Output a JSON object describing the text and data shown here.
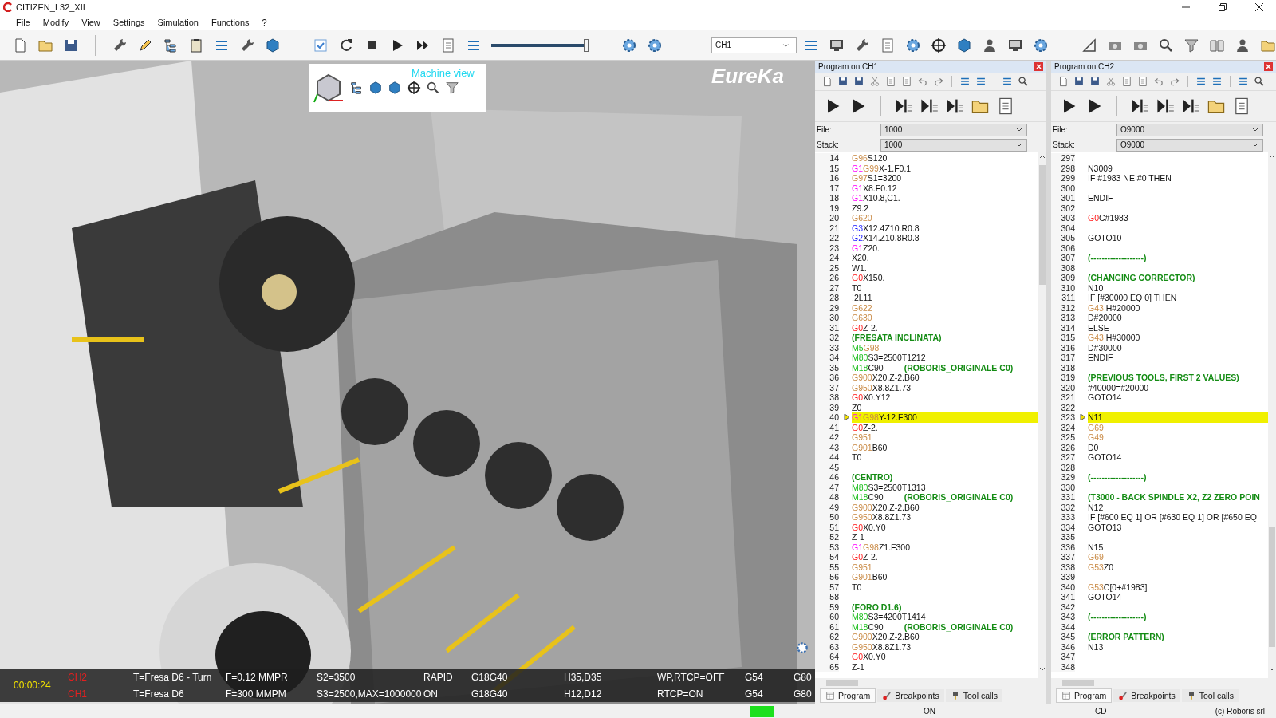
{
  "window": {
    "title": "CITIZEN_L32_XII"
  },
  "menu": [
    "File",
    "Modify",
    "View",
    "Settings",
    "Simulation",
    "Functions",
    "?"
  ],
  "toolbar": {
    "speed_slider": {
      "level": 0.97
    },
    "channel": "CH1"
  },
  "viewport": {
    "view_label": "Machine view",
    "logo": "EureKa",
    "timer": "00:00:24",
    "channels": [
      {
        "name": "CH2",
        "tool": "T=Fresa D6 - Turn",
        "feed": "F=0.12 MMPR",
        "speed": "S2=3500",
        "motion": "RAPID",
        "plane": "G18G40",
        "offsets": "H35,D35",
        "rtcp": "WP,RTCP=OFF",
        "work": "G54",
        "cycle": "G80"
      },
      {
        "name": "CH1",
        "tool": "T=Fresa D6",
        "feed": "F=300 MMPM",
        "speed": "S3=2500,MAX=1000000",
        "motion": "ON",
        "plane": "G18G40",
        "offsets": "H12,D12",
        "rtcp": "RTCP=ON",
        "work": "G54",
        "cycle": "G80"
      }
    ]
  },
  "panels": [
    {
      "title": "Program on CH1",
      "file": {
        "label": "File:",
        "value": "1000"
      },
      "stack": {
        "label": "Stack:",
        "value": "1000"
      },
      "lines": [
        {
          "n": "14",
          "current": false,
          "code": [
            {
              "text": "G96",
              "kind": "modal"
            },
            {
              "text": "S120",
              "kind": "plain"
            }
          ]
        },
        {
          "n": "15",
          "current": false,
          "code": [
            {
              "text": "G1",
              "kind": "linear"
            },
            {
              "text": "G99",
              "kind": "modal"
            },
            {
              "text": "X-1.F0.1",
              "kind": "plain"
            }
          ]
        },
        {
          "n": "16",
          "current": false,
          "code": [
            {
              "text": "G97",
              "kind": "modal"
            },
            {
              "text": "S1=3200",
              "kind": "plain"
            }
          ]
        },
        {
          "n": "17",
          "current": false,
          "code": [
            {
              "text": "G1",
              "kind": "linear"
            },
            {
              "text": "X8.F0.12",
              "kind": "plain"
            }
          ]
        },
        {
          "n": "18",
          "current": false,
          "code": [
            {
              "text": "G1",
              "kind": "linear"
            },
            {
              "text": "X10.8,C1.",
              "kind": "plain"
            }
          ]
        },
        {
          "n": "19",
          "current": false,
          "code": [
            {
              "text": "Z9.2",
              "kind": "plain"
            }
          ]
        },
        {
          "n": "20",
          "current": false,
          "code": [
            {
              "text": "G620",
              "kind": "modal"
            }
          ]
        },
        {
          "n": "21",
          "current": false,
          "code": [
            {
              "text": "G3",
              "kind": "arc"
            },
            {
              "text": "X12.4Z10.R0.8",
              "kind": "plain"
            }
          ]
        },
        {
          "n": "22",
          "current": false,
          "code": [
            {
              "text": "G2",
              "kind": "arc"
            },
            {
              "text": "X14.Z10.8R0.8",
              "kind": "plain"
            }
          ]
        },
        {
          "n": "23",
          "current": false,
          "code": [
            {
              "text": "G1",
              "kind": "linear"
            },
            {
              "text": "Z20.",
              "kind": "plain"
            }
          ]
        },
        {
          "n": "24",
          "current": false,
          "code": [
            {
              "text": "X20.",
              "kind": "plain"
            }
          ]
        },
        {
          "n": "25",
          "current": false,
          "code": [
            {
              "text": "W1.",
              "kind": "plain"
            }
          ]
        },
        {
          "n": "26",
          "current": false,
          "code": [
            {
              "text": "G0",
              "kind": "rapid"
            },
            {
              "text": "X150.",
              "kind": "plain"
            }
          ]
        },
        {
          "n": "27",
          "current": false,
          "code": [
            {
              "text": "T0",
              "kind": "plain"
            }
          ]
        },
        {
          "n": "28",
          "current": false,
          "code": [
            {
              "text": "!2L11",
              "kind": "plain"
            }
          ]
        },
        {
          "n": "29",
          "current": false,
          "code": [
            {
              "text": "G622",
              "kind": "modal"
            }
          ]
        },
        {
          "n": "30",
          "current": false,
          "code": [
            {
              "text": "G630",
              "kind": "modal"
            }
          ]
        },
        {
          "n": "31",
          "current": false,
          "code": [
            {
              "text": "G0",
              "kind": "rapid"
            },
            {
              "text": "Z-2.",
              "kind": "plain"
            }
          ]
        },
        {
          "n": "32",
          "current": false,
          "code": [
            {
              "text": "(FRESATA INCLINATA)",
              "kind": "comment"
            }
          ]
        },
        {
          "n": "33",
          "current": false,
          "code": [
            {
              "text": "M5",
              "kind": "mcode"
            },
            {
              "text": "G98",
              "kind": "modal"
            }
          ]
        },
        {
          "n": "34",
          "current": false,
          "code": [
            {
              "text": "M80",
              "kind": "mcode"
            },
            {
              "text": "S3=2500T1212",
              "kind": "plain"
            }
          ]
        },
        {
          "n": "35",
          "current": false,
          "code": [
            {
              "text": "M18",
              "kind": "mcode"
            },
            {
              "text": "C90",
              "kind": "plain"
            },
            {
              "text": "(ROBORIS_ORIGINALE C0)",
              "kind": "comment"
            }
          ]
        },
        {
          "n": "36",
          "current": false,
          "code": [
            {
              "text": "G900",
              "kind": "modal"
            },
            {
              "text": "X20.Z-2.B60",
              "kind": "plain"
            }
          ]
        },
        {
          "n": "37",
          "current": false,
          "code": [
            {
              "text": "G950",
              "kind": "modal"
            },
            {
              "text": "X8.8Z1.73",
              "kind": "plain"
            }
          ]
        },
        {
          "n": "38",
          "current": false,
          "code": [
            {
              "text": "G0",
              "kind": "rapid"
            },
            {
              "text": "X0.Y12",
              "kind": "plain"
            }
          ]
        },
        {
          "n": "39",
          "current": false,
          "code": [
            {
              "text": "Z0",
              "kind": "plain"
            }
          ]
        },
        {
          "n": "40",
          "current": true,
          "code": [
            {
              "text": "G1",
              "kind": "linear"
            },
            {
              "text": "G98",
              "kind": "modal"
            },
            {
              "text": "Y-12.F300",
              "kind": "plain"
            }
          ]
        },
        {
          "n": "41",
          "current": false,
          "code": [
            {
              "text": "G0",
              "kind": "rapid"
            },
            {
              "text": "Z-2.",
              "kind": "plain"
            }
          ]
        },
        {
          "n": "42",
          "current": false,
          "code": [
            {
              "text": "G951",
              "kind": "modal"
            }
          ]
        },
        {
          "n": "43",
          "current": false,
          "code": [
            {
              "text": "G901",
              "kind": "modal"
            },
            {
              "text": "B60",
              "kind": "plain"
            }
          ]
        },
        {
          "n": "44",
          "current": false,
          "code": [
            {
              "text": "T0",
              "kind": "plain"
            }
          ]
        },
        {
          "n": "45",
          "current": false
        },
        {
          "n": "46",
          "current": false,
          "code": [
            {
              "text": "(CENTRO)",
              "kind": "comment"
            }
          ]
        },
        {
          "n": "47",
          "current": false,
          "code": [
            {
              "text": "M80",
              "kind": "mcode"
            },
            {
              "text": "S3=2500T1313",
              "kind": "plain"
            }
          ]
        },
        {
          "n": "48",
          "current": false,
          "code": [
            {
              "text": "M18",
              "kind": "mcode"
            },
            {
              "text": "C90",
              "kind": "plain"
            },
            {
              "text": "(ROBORIS_ORIGINALE C0)",
              "kind": "comment"
            }
          ]
        },
        {
          "n": "49",
          "current": false,
          "code": [
            {
              "text": "G900",
              "kind": "modal"
            },
            {
              "text": "X20.Z-2.B60",
              "kind": "plain"
            }
          ]
        },
        {
          "n": "50",
          "current": false,
          "code": [
            {
              "text": "G950",
              "kind": "modal"
            },
            {
              "text": "X8.8Z1.73",
              "kind": "plain"
            }
          ]
        },
        {
          "n": "51",
          "current": false,
          "code": [
            {
              "text": "G0",
              "kind": "rapid"
            },
            {
              "text": "X0.Y0",
              "kind": "plain"
            }
          ]
        },
        {
          "n": "52",
          "current": false,
          "code": [
            {
              "text": "Z-1",
              "kind": "plain"
            }
          ]
        },
        {
          "n": "53",
          "current": false,
          "code": [
            {
              "text": "G1",
              "kind": "linear"
            },
            {
              "text": "G98",
              "kind": "modal"
            },
            {
              "text": "Z1.F300",
              "kind": "plain"
            }
          ]
        },
        {
          "n": "54",
          "current": false,
          "code": [
            {
              "text": "G0",
              "kind": "rapid"
            },
            {
              "text": "Z-2.",
              "kind": "plain"
            }
          ]
        },
        {
          "n": "55",
          "current": false,
          "code": [
            {
              "text": "G951",
              "kind": "modal"
            }
          ]
        },
        {
          "n": "56",
          "current": false,
          "code": [
            {
              "text": "G901",
              "kind": "modal"
            },
            {
              "text": "B60",
              "kind": "plain"
            }
          ]
        },
        {
          "n": "57",
          "current": false,
          "code": [
            {
              "text": "T0",
              "kind": "plain"
            }
          ]
        },
        {
          "n": "58",
          "current": false
        },
        {
          "n": "59",
          "current": false,
          "code": [
            {
              "text": "(FORO D1.6)",
              "kind": "comment"
            }
          ]
        },
        {
          "n": "60",
          "current": false,
          "code": [
            {
              "text": "M80",
              "kind": "mcode"
            },
            {
              "text": "S3=4200T1414",
              "kind": "plain"
            }
          ]
        },
        {
          "n": "61",
          "current": false,
          "code": [
            {
              "text": "M18",
              "kind": "mcode"
            },
            {
              "text": "C90",
              "kind": "plain"
            },
            {
              "text": "(ROBORIS_ORIGINALE C0)",
              "kind": "comment"
            }
          ]
        },
        {
          "n": "62",
          "current": false,
          "code": [
            {
              "text": "G900",
              "kind": "modal"
            },
            {
              "text": "X20.Z-2.B60",
              "kind": "plain"
            }
          ]
        },
        {
          "n": "63",
          "current": false,
          "code": [
            {
              "text": "G950",
              "kind": "modal"
            },
            {
              "text": "X8.8Z1.73",
              "kind": "plain"
            }
          ]
        },
        {
          "n": "64",
          "current": false,
          "code": [
            {
              "text": "G0",
              "kind": "rapid"
            },
            {
              "text": "X0.Y0",
              "kind": "plain"
            }
          ]
        },
        {
          "n": "65",
          "current": false,
          "code": [
            {
              "text": "Z-1",
              "kind": "plain"
            }
          ]
        }
      ],
      "tabs": [
        {
          "label": "Program",
          "selected": true
        },
        {
          "label": "Breakpoints",
          "selected": false
        },
        {
          "label": "Tool calls",
          "selected": false
        }
      ]
    },
    {
      "title": "Program on CH2",
      "file": {
        "label": "File:",
        "value": "O9000"
      },
      "stack": {
        "label": "Stack:",
        "value": "O9000"
      },
      "lines": [
        {
          "n": "297",
          "current": false
        },
        {
          "n": "298",
          "current": false,
          "code": [
            {
              "text": "N3009",
              "kind": "plain"
            }
          ]
        },
        {
          "n": "299",
          "current": false,
          "code": [
            {
              "text": "IF #1983 NE #0 THEN",
              "kind": "plain"
            }
          ]
        },
        {
          "n": "300",
          "current": false
        },
        {
          "n": "301",
          "current": false,
          "code": [
            {
              "text": "ENDIF",
              "kind": "plain"
            }
          ]
        },
        {
          "n": "302",
          "current": false
        },
        {
          "n": "303",
          "current": false,
          "code": [
            {
              "text": "G0",
              "kind": "rapid"
            },
            {
              "text": "C#1983",
              "kind": "plain"
            }
          ]
        },
        {
          "n": "304",
          "current": false
        },
        {
          "n": "305",
          "current": false,
          "code": [
            {
              "text": "GOTO10",
              "kind": "plain"
            }
          ]
        },
        {
          "n": "306",
          "current": false
        },
        {
          "n": "307",
          "current": false,
          "code": [
            {
              "text": "(-------------------)",
              "kind": "comment"
            }
          ]
        },
        {
          "n": "308",
          "current": false
        },
        {
          "n": "309",
          "current": false,
          "code": [
            {
              "text": "(CHANGING CORRECTOR)",
              "kind": "comment"
            }
          ]
        },
        {
          "n": "310",
          "current": false,
          "code": [
            {
              "text": "N10",
              "kind": "plain"
            }
          ]
        },
        {
          "n": "311",
          "current": false,
          "code": [
            {
              "text": "IF [#30000 EQ 0] THEN",
              "kind": "plain"
            }
          ]
        },
        {
          "n": "312",
          "current": false,
          "code": [
            {
              "text": "G43",
              "kind": "modal"
            },
            {
              "text": " H#20000",
              "kind": "plain"
            }
          ]
        },
        {
          "n": "313",
          "current": false,
          "code": [
            {
              "text": "D#20000",
              "kind": "plain"
            }
          ]
        },
        {
          "n": "314",
          "current": false,
          "code": [
            {
              "text": "ELSE",
              "kind": "plain"
            }
          ]
        },
        {
          "n": "315",
          "current": false,
          "code": [
            {
              "text": "G43",
              "kind": "modal"
            },
            {
              "text": " H#30000",
              "kind": "plain"
            }
          ]
        },
        {
          "n": "316",
          "current": false,
          "code": [
            {
              "text": "D#30000",
              "kind": "plain"
            }
          ]
        },
        {
          "n": "317",
          "current": false,
          "code": [
            {
              "text": "ENDIF",
              "kind": "plain"
            }
          ]
        },
        {
          "n": "318",
          "current": false
        },
        {
          "n": "319",
          "current": false,
          "code": [
            {
              "text": "(PREVIOUS TOOLS, FIRST 2 VALUES)",
              "kind": "comment"
            }
          ]
        },
        {
          "n": "320",
          "current": false,
          "code": [
            {
              "text": "#40000=#20000",
              "kind": "plain"
            }
          ]
        },
        {
          "n": "321",
          "current": false,
          "code": [
            {
              "text": "GOTO14",
              "kind": "plain"
            }
          ]
        },
        {
          "n": "322",
          "current": false
        },
        {
          "n": "323",
          "current": true,
          "code": [
            {
              "text": "N11",
              "kind": "plain"
            }
          ]
        },
        {
          "n": "324",
          "current": false,
          "code": [
            {
              "text": "G69",
              "kind": "modal"
            }
          ]
        },
        {
          "n": "325",
          "current": false,
          "code": [
            {
              "text": "G49",
              "kind": "modal"
            }
          ]
        },
        {
          "n": "326",
          "current": false,
          "code": [
            {
              "text": "D0",
              "kind": "plain"
            }
          ]
        },
        {
          "n": "327",
          "current": false,
          "code": [
            {
              "text": "GOTO14",
              "kind": "plain"
            }
          ]
        },
        {
          "n": "328",
          "current": false
        },
        {
          "n": "329",
          "current": false,
          "code": [
            {
              "text": "(-------------------)",
              "kind": "comment"
            }
          ]
        },
        {
          "n": "330",
          "current": false
        },
        {
          "n": "331",
          "current": false,
          "code": [
            {
              "text": "(T3000 - BACK SPINDLE X2, Z2 ZERO POIN",
              "kind": "comment"
            }
          ]
        },
        {
          "n": "332",
          "current": false,
          "code": [
            {
              "text": "N12",
              "kind": "plain"
            }
          ]
        },
        {
          "n": "333",
          "current": false,
          "code": [
            {
              "text": "IF [#600 EQ 1] OR [#630 EQ 1] OR [#650 EQ",
              "kind": "plain"
            }
          ]
        },
        {
          "n": "334",
          "current": false,
          "code": [
            {
              "text": "GOTO13",
              "kind": "plain"
            }
          ]
        },
        {
          "n": "335",
          "current": false
        },
        {
          "n": "336",
          "current": false,
          "code": [
            {
              "text": "N15",
              "kind": "plain"
            }
          ]
        },
        {
          "n": "337",
          "current": false,
          "code": [
            {
              "text": "G69",
              "kind": "modal"
            }
          ]
        },
        {
          "n": "338",
          "current": false,
          "code": [
            {
              "text": "G53",
              "kind": "modal"
            },
            {
              "text": "Z0",
              "kind": "plain"
            }
          ]
        },
        {
          "n": "339",
          "current": false
        },
        {
          "n": "340",
          "current": false,
          "code": [
            {
              "text": "G53",
              "kind": "modal"
            },
            {
              "text": "C[0+#1983]",
              "kind": "plain"
            }
          ]
        },
        {
          "n": "341",
          "current": false,
          "code": [
            {
              "text": "GOTO14",
              "kind": "plain"
            }
          ]
        },
        {
          "n": "342",
          "current": false
        },
        {
          "n": "343",
          "current": false,
          "code": [
            {
              "text": "(-------------------)",
              "kind": "comment"
            }
          ]
        },
        {
          "n": "344",
          "current": false
        },
        {
          "n": "345",
          "current": false,
          "code": [
            {
              "text": "(ERROR PATTERN)",
              "kind": "comment"
            }
          ]
        },
        {
          "n": "346",
          "current": false,
          "code": [
            {
              "text": "N13",
              "kind": "plain"
            }
          ]
        },
        {
          "n": "347",
          "current": false
        },
        {
          "n": "348",
          "current": false
        }
      ],
      "tabs": [
        {
          "label": "Program",
          "selected": true
        },
        {
          "label": "Breakpoints",
          "selected": false
        },
        {
          "label": "Tool calls",
          "selected": false
        }
      ]
    }
  ],
  "status_bar": {
    "mode": "ON",
    "drive": "CD",
    "copyright": "(c) Roboris srl"
  }
}
